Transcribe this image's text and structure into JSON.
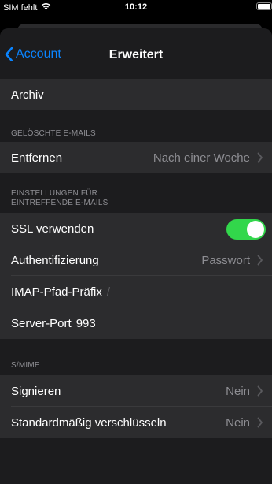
{
  "status": {
    "carrier": "SIM fehlt",
    "time": "10:12"
  },
  "nav": {
    "back_label": "Account",
    "title": "Erweitert"
  },
  "archive": {
    "label": "Archiv"
  },
  "deleted_section": {
    "header": "GELÖSCHTE E-MAILS",
    "remove_label": "Entfernen",
    "remove_value": "Nach einer Woche"
  },
  "incoming_section": {
    "header_line1": "EINSTELLUNGEN FÜR",
    "header_line2": "EINTREFFENDE E-MAILS",
    "ssl_label": "SSL verwenden",
    "ssl_enabled": true,
    "auth_label": "Authentifizierung",
    "auth_value": "Passwort",
    "imap_label": "IMAP-Pfad-Präfix",
    "imap_value": "/",
    "port_label": "Server-Port",
    "port_value": "993"
  },
  "smime_section": {
    "header": "S/MIME",
    "sign_label": "Signieren",
    "sign_value": "Nein",
    "encrypt_label": "Standardmäßig verschlüsseln",
    "encrypt_value": "Nein"
  },
  "colors": {
    "accent": "#0a84ff",
    "toggle_on": "#32d74b",
    "background": "#1c1c1e",
    "cell": "#2c2c2e"
  }
}
